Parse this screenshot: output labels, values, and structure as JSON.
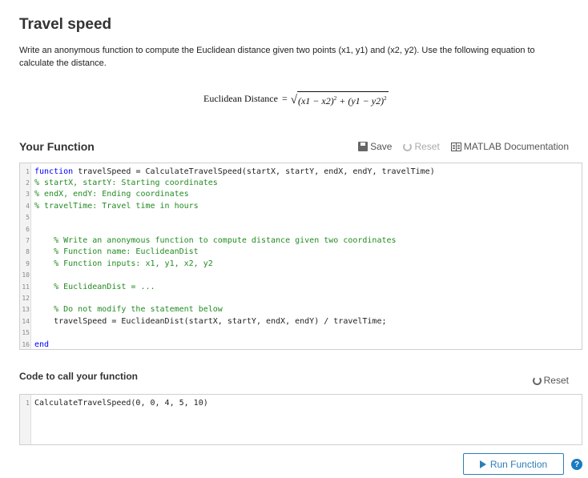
{
  "page": {
    "title": "Travel speed",
    "description": "Write an anonymous function to compute the Euclidean distance given two points (x1, y1) and (x2, y2). Use the following equation to calculate the distance."
  },
  "equation": {
    "lhs": "Euclidean  Distance",
    "eq": "=",
    "sqrt": "√",
    "term1": "(x1 − x2)",
    "plus": " + ",
    "term2": "(y1 − y2)",
    "exp": "2"
  },
  "your_function": {
    "title": "Your Function",
    "toolbar": {
      "save_label": "Save",
      "reset_label": "Reset",
      "docs_label": "MATLAB Documentation"
    },
    "lines": [
      {
        "n": "1",
        "text": "function travelSpeed = CalculateTravelSpeed(startX, startY, endX, endY, travelTime)",
        "kind": "normal"
      },
      {
        "n": "2",
        "text": "% startX, startY: Starting coordinates",
        "kind": "comment"
      },
      {
        "n": "3",
        "text": "% endX, endY: Ending coordinates",
        "kind": "comment"
      },
      {
        "n": "4",
        "text": "% travelTime: Travel time in hours",
        "kind": "comment"
      },
      {
        "n": "5",
        "text": "",
        "kind": "normal"
      },
      {
        "n": "6",
        "text": "",
        "kind": "normal"
      },
      {
        "n": "7",
        "text": "    % Write an anonymous function to compute distance given two coordinates",
        "kind": "comment"
      },
      {
        "n": "8",
        "text": "    % Function name: EuclideanDist",
        "kind": "comment"
      },
      {
        "n": "9",
        "text": "    % Function inputs: x1, y1, x2, y2",
        "kind": "comment"
      },
      {
        "n": "10",
        "text": "",
        "kind": "normal"
      },
      {
        "n": "11",
        "text": "    % EuclideanDist = ...",
        "kind": "comment"
      },
      {
        "n": "12",
        "text": "",
        "kind": "normal"
      },
      {
        "n": "13",
        "text": "    % Do not modify the statement below",
        "kind": "comment"
      },
      {
        "n": "14",
        "text": "    travelSpeed = EuclideanDist(startX, startY, endX, endY) / travelTime;",
        "kind": "normal"
      },
      {
        "n": "15",
        "text": "",
        "kind": "normal"
      },
      {
        "n": "16",
        "text": "end",
        "kind": "keyword"
      }
    ]
  },
  "call_section": {
    "title": "Code to call your function",
    "reset_label": "Reset",
    "lines": [
      {
        "n": "1",
        "text": "CalculateTravelSpeed(0, 0, 4, 5, 10)",
        "kind": "normal"
      }
    ]
  },
  "actions": {
    "run_label": "Run Function",
    "help_glyph": "?"
  },
  "colors": {
    "accent": "#2c7fb8",
    "keyword": "#0000ff",
    "comment": "#228b22"
  }
}
